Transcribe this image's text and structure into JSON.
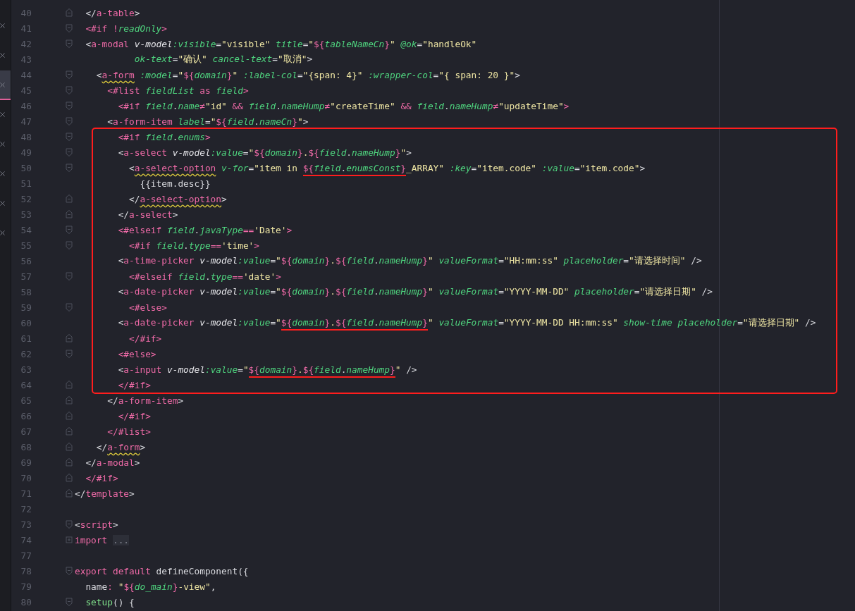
{
  "tabs": [
    {
      "selected": false
    },
    {
      "selected": false
    },
    {
      "selected": true
    },
    {
      "selected": false
    },
    {
      "selected": false
    },
    {
      "selected": false
    },
    {
      "selected": false
    },
    {
      "selected": false
    }
  ],
  "lines_before": [
    {
      "number": "40",
      "fold_end": true,
      "tokens": [
        {
          "text": "  </",
          "kind": "punct"
        },
        {
          "text": "a-table",
          "kind": "tag"
        },
        {
          "text": ">",
          "kind": "punct"
        }
      ]
    },
    {
      "number": "41",
      "fold_start": true,
      "tokens": [
        {
          "text": "  <#if ",
          "kind": "tag"
        },
        {
          "text": "!",
          "kind": "op"
        },
        {
          "text": "readOnly",
          "kind": "var"
        },
        {
          "text": ">",
          "kind": "tag"
        }
      ]
    },
    {
      "number": "42",
      "fold_start": true,
      "tokens": [
        {
          "text": "  <",
          "kind": "punct"
        },
        {
          "text": "a-modal ",
          "kind": "tag"
        },
        {
          "text": "v-model",
          "kind": "directive"
        },
        {
          "text": ":visible",
          "kind": "attr"
        },
        {
          "text": "=",
          "kind": "punct"
        },
        {
          "text": "\"visible\" ",
          "kind": "string"
        },
        {
          "text": "title",
          "kind": "attr"
        },
        {
          "text": "=",
          "kind": "punct"
        },
        {
          "text": "\"",
          "kind": "string"
        },
        {
          "text": "${",
          "kind": "tag"
        },
        {
          "text": "tableNameCn",
          "kind": "var"
        },
        {
          "text": "}",
          "kind": "tag"
        },
        {
          "text": "\" ",
          "kind": "string"
        },
        {
          "text": "@ok",
          "kind": "attr"
        },
        {
          "text": "=",
          "kind": "punct"
        },
        {
          "text": "\"handleOk\"",
          "kind": "string"
        }
      ]
    },
    {
      "number": "43",
      "tokens": [
        {
          "text": "           ok-text",
          "kind": "attr"
        },
        {
          "text": "=",
          "kind": "punct"
        },
        {
          "text": "\"确认\" ",
          "kind": "string"
        },
        {
          "text": "cancel-text",
          "kind": "attr"
        },
        {
          "text": "=",
          "kind": "punct"
        },
        {
          "text": "\"取消\"",
          "kind": "string"
        },
        {
          "text": ">",
          "kind": "punct"
        }
      ]
    },
    {
      "number": "44",
      "fold_start": true,
      "tokens": [
        {
          "text": "    <",
          "kind": "punct"
        },
        {
          "text": "a-form",
          "kind": "tag_warn"
        },
        {
          "text": " :model",
          "kind": "attr"
        },
        {
          "text": "=",
          "kind": "punct"
        },
        {
          "text": "\"",
          "kind": "string"
        },
        {
          "text": "${",
          "kind": "tag"
        },
        {
          "text": "domain",
          "kind": "var"
        },
        {
          "text": "}",
          "kind": "tag"
        },
        {
          "text": "\" ",
          "kind": "string"
        },
        {
          "text": ":label-col",
          "kind": "attr"
        },
        {
          "text": "=",
          "kind": "punct"
        },
        {
          "text": "\"{span: 4}\" ",
          "kind": "string"
        },
        {
          "text": ":wrapper-col",
          "kind": "attr"
        },
        {
          "text": "=",
          "kind": "punct"
        },
        {
          "text": "\"{ span: 20 }\"",
          "kind": "string"
        },
        {
          "text": ">",
          "kind": "punct"
        }
      ]
    },
    {
      "number": "45",
      "fold_start": true,
      "tokens": [
        {
          "text": "      <#list ",
          "kind": "tag"
        },
        {
          "text": "fieldList",
          "kind": "var"
        },
        {
          "text": " as ",
          "kind": "tag"
        },
        {
          "text": "field",
          "kind": "var"
        },
        {
          "text": ">",
          "kind": "tag"
        }
      ]
    },
    {
      "number": "46",
      "fold_start": true,
      "tokens": [
        {
          "text": "        <#if ",
          "kind": "tag"
        },
        {
          "text": "field",
          "kind": "var"
        },
        {
          "text": ".",
          "kind": "punct"
        },
        {
          "text": "name",
          "kind": "var"
        },
        {
          "text": "≠",
          "kind": "op"
        },
        {
          "text": "\"id\" ",
          "kind": "string"
        },
        {
          "text": "&& ",
          "kind": "op"
        },
        {
          "text": "field",
          "kind": "var"
        },
        {
          "text": ".",
          "kind": "punct"
        },
        {
          "text": "nameHump",
          "kind": "var"
        },
        {
          "text": "≠",
          "kind": "op"
        },
        {
          "text": "\"createTime\" ",
          "kind": "string"
        },
        {
          "text": "&& ",
          "kind": "op"
        },
        {
          "text": "field",
          "kind": "var"
        },
        {
          "text": ".",
          "kind": "punct"
        },
        {
          "text": "nameHump",
          "kind": "var"
        },
        {
          "text": "≠",
          "kind": "op"
        },
        {
          "text": "\"updateTime\"",
          "kind": "string"
        },
        {
          "text": ">",
          "kind": "tag"
        }
      ]
    },
    {
      "number": "47",
      "fold_start": true,
      "tokens": [
        {
          "text": "      <",
          "kind": "punct"
        },
        {
          "text": "a-form-item ",
          "kind": "tag"
        },
        {
          "text": "label",
          "kind": "attr"
        },
        {
          "text": "=",
          "kind": "punct"
        },
        {
          "text": "\"",
          "kind": "string"
        },
        {
          "text": "${",
          "kind": "tag"
        },
        {
          "text": "field",
          "kind": "var"
        },
        {
          "text": ".",
          "kind": "punct"
        },
        {
          "text": "nameCn",
          "kind": "var"
        },
        {
          "text": "}",
          "kind": "tag"
        },
        {
          "text": "\"",
          "kind": "string"
        },
        {
          "text": ">",
          "kind": "punct"
        }
      ]
    }
  ],
  "highlighted_block": {
    "lines": [
      {
        "number": "48",
        "fold_start": true,
        "tokens": [
          {
            "text": "        <#if ",
            "kind": "tag"
          },
          {
            "text": "field",
            "kind": "var"
          },
          {
            "text": ".",
            "kind": "punct"
          },
          {
            "text": "enums",
            "kind": "var"
          },
          {
            "text": ">",
            "kind": "tag"
          }
        ]
      },
      {
        "number": "49",
        "fold_start": true,
        "tokens": [
          {
            "text": "        <",
            "kind": "punct"
          },
          {
            "text": "a-select ",
            "kind": "tag"
          },
          {
            "text": "v-model",
            "kind": "directive"
          },
          {
            "text": ":value",
            "kind": "attr"
          },
          {
            "text": "=",
            "kind": "punct"
          },
          {
            "text": "\"",
            "kind": "string"
          },
          {
            "text": "${",
            "kind": "tag"
          },
          {
            "text": "domain",
            "kind": "var"
          },
          {
            "text": "}",
            "kind": "tag"
          },
          {
            "text": ".",
            "kind": "string"
          },
          {
            "text": "${",
            "kind": "tag"
          },
          {
            "text": "field",
            "kind": "var"
          },
          {
            "text": ".",
            "kind": "punct"
          },
          {
            "text": "nameHump",
            "kind": "var"
          },
          {
            "text": "}",
            "kind": "tag"
          },
          {
            "text": "\"",
            "kind": "string"
          },
          {
            "text": ">",
            "kind": "punct"
          }
        ]
      },
      {
        "number": "50",
        "fold_start": true,
        "tokens": [
          {
            "text": "          <",
            "kind": "punct"
          },
          {
            "text": "a-select-option",
            "kind": "tag_warn"
          },
          {
            "text": " v-for",
            "kind": "attr"
          },
          {
            "text": "=",
            "kind": "punct"
          },
          {
            "text": "\"item in ",
            "kind": "string"
          },
          {
            "kind": "mark",
            "tokens": [
              {
                "text": "${",
                "kind": "tag"
              },
              {
                "text": "field",
                "kind": "var"
              },
              {
                "text": ".",
                "kind": "punct"
              },
              {
                "text": "enumsConst",
                "kind": "var"
              },
              {
                "text": "}",
                "kind": "tag"
              }
            ]
          },
          {
            "text": "_ARRAY\" ",
            "kind": "string"
          },
          {
            "text": ":key",
            "kind": "attr"
          },
          {
            "text": "=",
            "kind": "punct"
          },
          {
            "text": "\"item.code\" ",
            "kind": "string"
          },
          {
            "text": ":value",
            "kind": "attr"
          },
          {
            "text": "=",
            "kind": "punct"
          },
          {
            "text": "\"item.code\"",
            "kind": "string"
          },
          {
            "text": ">",
            "kind": "punct"
          }
        ]
      },
      {
        "number": "51",
        "tokens": [
          {
            "text": "            {{item.desc}}",
            "kind": "punct"
          }
        ]
      },
      {
        "number": "52",
        "fold_end": true,
        "tokens": [
          {
            "text": "          </",
            "kind": "punct"
          },
          {
            "text": "a-select-option",
            "kind": "tag_warn"
          },
          {
            "text": ">",
            "kind": "punct"
          }
        ]
      },
      {
        "number": "53",
        "fold_end": true,
        "tokens": [
          {
            "text": "        </",
            "kind": "punct"
          },
          {
            "text": "a-select",
            "kind": "tag"
          },
          {
            "text": ">",
            "kind": "punct"
          }
        ]
      },
      {
        "number": "54",
        "fold_start": true,
        "tokens": [
          {
            "text": "        <#elseif ",
            "kind": "tag"
          },
          {
            "text": "field",
            "kind": "var"
          },
          {
            "text": ".",
            "kind": "punct"
          },
          {
            "text": "javaType",
            "kind": "var"
          },
          {
            "text": "==",
            "kind": "op"
          },
          {
            "text": "'Date'",
            "kind": "string"
          },
          {
            "text": ">",
            "kind": "tag"
          }
        ]
      },
      {
        "number": "55",
        "fold_start": true,
        "tokens": [
          {
            "text": "          <#if ",
            "kind": "tag"
          },
          {
            "text": "field",
            "kind": "var"
          },
          {
            "text": ".",
            "kind": "punct"
          },
          {
            "text": "type",
            "kind": "var"
          },
          {
            "text": "==",
            "kind": "op"
          },
          {
            "text": "'time'",
            "kind": "string"
          },
          {
            "text": ">",
            "kind": "tag"
          }
        ]
      },
      {
        "number": "56",
        "tokens": [
          {
            "text": "        <",
            "kind": "punct"
          },
          {
            "text": "a-time-picker ",
            "kind": "tag"
          },
          {
            "text": "v-model",
            "kind": "directive"
          },
          {
            "text": ":value",
            "kind": "attr"
          },
          {
            "text": "=",
            "kind": "punct"
          },
          {
            "text": "\"",
            "kind": "string"
          },
          {
            "text": "${",
            "kind": "tag"
          },
          {
            "text": "domain",
            "kind": "var"
          },
          {
            "text": "}",
            "kind": "tag"
          },
          {
            "text": ".",
            "kind": "string"
          },
          {
            "text": "${",
            "kind": "tag"
          },
          {
            "text": "field",
            "kind": "var"
          },
          {
            "text": ".",
            "kind": "punct"
          },
          {
            "text": "nameHump",
            "kind": "var"
          },
          {
            "text": "}",
            "kind": "tag"
          },
          {
            "text": "\" ",
            "kind": "string"
          },
          {
            "text": "valueFormat",
            "kind": "attr"
          },
          {
            "text": "=",
            "kind": "punct"
          },
          {
            "text": "\"HH:mm:ss\" ",
            "kind": "string"
          },
          {
            "text": "placeholder",
            "kind": "attr"
          },
          {
            "text": "=",
            "kind": "punct"
          },
          {
            "text": "\"请选择时间\"",
            "kind": "string"
          },
          {
            "text": " />",
            "kind": "punct"
          }
        ]
      },
      {
        "number": "57",
        "fold_start": true,
        "tokens": [
          {
            "text": "          <#elseif ",
            "kind": "tag"
          },
          {
            "text": "field",
            "kind": "var"
          },
          {
            "text": ".",
            "kind": "punct"
          },
          {
            "text": "type",
            "kind": "var"
          },
          {
            "text": "==",
            "kind": "op"
          },
          {
            "text": "'date'",
            "kind": "string"
          },
          {
            "text": ">",
            "kind": "tag"
          }
        ]
      },
      {
        "number": "58",
        "tokens": [
          {
            "text": "        <",
            "kind": "punct"
          },
          {
            "text": "a-date-picker ",
            "kind": "tag"
          },
          {
            "text": "v-model",
            "kind": "directive"
          },
          {
            "text": ":value",
            "kind": "attr"
          },
          {
            "text": "=",
            "kind": "punct"
          },
          {
            "text": "\"",
            "kind": "string"
          },
          {
            "text": "${",
            "kind": "tag"
          },
          {
            "text": "domain",
            "kind": "var"
          },
          {
            "text": "}",
            "kind": "tag"
          },
          {
            "text": ".",
            "kind": "string"
          },
          {
            "text": "${",
            "kind": "tag"
          },
          {
            "text": "field",
            "kind": "var"
          },
          {
            "text": ".",
            "kind": "punct"
          },
          {
            "text": "nameHump",
            "kind": "var"
          },
          {
            "text": "}",
            "kind": "tag"
          },
          {
            "text": "\" ",
            "kind": "string"
          },
          {
            "text": "valueFormat",
            "kind": "attr"
          },
          {
            "text": "=",
            "kind": "punct"
          },
          {
            "text": "\"YYYY-MM-DD\" ",
            "kind": "string"
          },
          {
            "text": "placeholder",
            "kind": "attr"
          },
          {
            "text": "=",
            "kind": "punct"
          },
          {
            "text": "\"请选择日期\"",
            "kind": "string"
          },
          {
            "text": " />",
            "kind": "punct"
          }
        ]
      },
      {
        "number": "59",
        "fold_start": true,
        "tokens": [
          {
            "text": "          <#else>",
            "kind": "tag"
          }
        ]
      },
      {
        "number": "60",
        "tokens": [
          {
            "text": "        <",
            "kind": "punct"
          },
          {
            "text": "a-date-picker ",
            "kind": "tag"
          },
          {
            "text": "v-model",
            "kind": "directive"
          },
          {
            "text": ":value",
            "kind": "attr"
          },
          {
            "text": "=",
            "kind": "punct"
          },
          {
            "text": "\"",
            "kind": "string"
          },
          {
            "kind": "mark",
            "tokens": [
              {
                "text": "${",
                "kind": "tag"
              },
              {
                "text": "domain",
                "kind": "var"
              },
              {
                "text": "}",
                "kind": "tag"
              },
              {
                "text": ".",
                "kind": "string"
              },
              {
                "text": "${",
                "kind": "tag"
              },
              {
                "text": "field",
                "kind": "var"
              },
              {
                "text": ".",
                "kind": "punct"
              },
              {
                "text": "nameHump",
                "kind": "var"
              },
              {
                "text": "}",
                "kind": "tag"
              }
            ]
          },
          {
            "text": "\" ",
            "kind": "string"
          },
          {
            "text": "valueFormat",
            "kind": "attr"
          },
          {
            "text": "=",
            "kind": "punct"
          },
          {
            "text": "\"YYYY-MM-DD HH:mm:ss\" ",
            "kind": "string"
          },
          {
            "text": "show-time placeholder",
            "kind": "attr"
          },
          {
            "text": "=",
            "kind": "punct"
          },
          {
            "text": "\"请选择日期\"",
            "kind": "string"
          },
          {
            "text": " />",
            "kind": "punct"
          }
        ]
      },
      {
        "number": "61",
        "fold_end": true,
        "tokens": [
          {
            "text": "          </#if>",
            "kind": "tag"
          }
        ]
      },
      {
        "number": "62",
        "fold_start": true,
        "tokens": [
          {
            "text": "        <#else>",
            "kind": "tag"
          }
        ]
      },
      {
        "number": "63",
        "tokens": [
          {
            "text": "        <",
            "kind": "punct"
          },
          {
            "text": "a-input ",
            "kind": "tag"
          },
          {
            "text": "v-model",
            "kind": "directive"
          },
          {
            "text": ":value",
            "kind": "attr"
          },
          {
            "text": "=",
            "kind": "punct"
          },
          {
            "text": "\"",
            "kind": "string"
          },
          {
            "kind": "mark",
            "tokens": [
              {
                "text": "${",
                "kind": "tag"
              },
              {
                "text": "domain",
                "kind": "var"
              },
              {
                "text": "}",
                "kind": "tag"
              },
              {
                "text": ".",
                "kind": "string"
              },
              {
                "text": "${",
                "kind": "tag"
              },
              {
                "text": "field",
                "kind": "var"
              },
              {
                "text": ".",
                "kind": "punct"
              },
              {
                "text": "nameHump",
                "kind": "var"
              },
              {
                "text": "}",
                "kind": "tag"
              }
            ]
          },
          {
            "text": "\"",
            "kind": "string"
          },
          {
            "text": " />",
            "kind": "punct"
          }
        ]
      },
      {
        "number": "64",
        "fold_end": true,
        "tokens": [
          {
            "text": "        </#if>",
            "kind": "tag"
          }
        ]
      }
    ]
  },
  "lines_after": [
    {
      "number": "65",
      "fold_end": true,
      "tokens": [
        {
          "text": "      </",
          "kind": "punct"
        },
        {
          "text": "a-form-item",
          "kind": "tag"
        },
        {
          "text": ">",
          "kind": "punct"
        }
      ]
    },
    {
      "number": "66",
      "fold_end": true,
      "tokens": [
        {
          "text": "        </#if>",
          "kind": "tag"
        }
      ]
    },
    {
      "number": "67",
      "fold_end": true,
      "tokens": [
        {
          "text": "      </#list>",
          "kind": "tag"
        }
      ]
    },
    {
      "number": "68",
      "fold_end": true,
      "tokens": [
        {
          "text": "    </",
          "kind": "punct"
        },
        {
          "text": "a-form",
          "kind": "tag_warn"
        },
        {
          "text": ">",
          "kind": "punct"
        }
      ]
    },
    {
      "number": "69",
      "fold_end": true,
      "tokens": [
        {
          "text": "  </",
          "kind": "punct"
        },
        {
          "text": "a-modal",
          "kind": "tag"
        },
        {
          "text": ">",
          "kind": "punct"
        }
      ]
    },
    {
      "number": "70",
      "fold_end": true,
      "tokens": [
        {
          "text": "  </#if>",
          "kind": "tag"
        }
      ]
    },
    {
      "number": "71",
      "fold_end": true,
      "tokens": [
        {
          "text": "</",
          "kind": "punct"
        },
        {
          "text": "template",
          "kind": "tag"
        },
        {
          "text": ">",
          "kind": "punct"
        }
      ]
    },
    {
      "number": "72"
    },
    {
      "number": "73",
      "fold_start": true,
      "tokens": [
        {
          "text": "<",
          "kind": "punct"
        },
        {
          "text": "script",
          "kind": "tag"
        },
        {
          "text": ">",
          "kind": "punct"
        }
      ]
    },
    {
      "number": "74",
      "collapsed": true,
      "tokens": [
        {
          "text": "import ",
          "kind": "keyword"
        },
        {
          "text": "...",
          "kind": "folded"
        }
      ]
    },
    {
      "number": "77"
    },
    {
      "number": "78",
      "fold_start": true,
      "tokens": [
        {
          "text": "export default",
          "kind": "keyword"
        },
        {
          "text": " defineComponent({",
          "kind": "punct"
        }
      ]
    },
    {
      "number": "79",
      "tokens": [
        {
          "text": "  name",
          "kind": "punct"
        },
        {
          "text": ": ",
          "kind": "op"
        },
        {
          "text": "\"",
          "kind": "string"
        },
        {
          "text": "${",
          "kind": "tag"
        },
        {
          "text": "do_main",
          "kind": "var"
        },
        {
          "text": "}",
          "kind": "tag"
        },
        {
          "text": "-view\"",
          "kind": "string"
        },
        {
          "text": ",",
          "kind": "punct"
        }
      ]
    },
    {
      "number": "80",
      "fold_start": true,
      "tokens": [
        {
          "text": "  setup",
          "kind": "func"
        },
        {
          "text": "() {",
          "kind": "punct"
        }
      ]
    }
  ]
}
